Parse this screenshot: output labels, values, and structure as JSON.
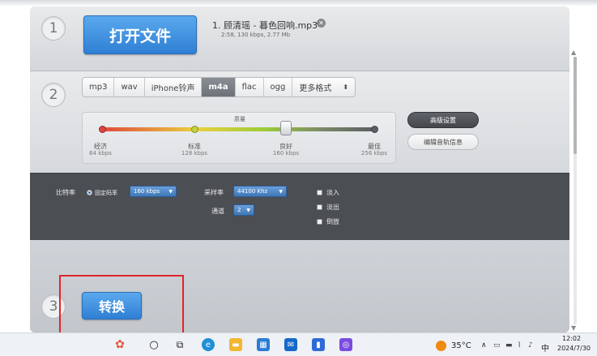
{
  "steps": {
    "one": "1",
    "two": "2",
    "three": "3"
  },
  "open_file_button": "打开文件",
  "file": {
    "name": "1. 顾清瑶 - 暮色回响.mp3",
    "meta": "2:58, 130 kbps, 2.77 Mb"
  },
  "formats": [
    {
      "label": "mp3",
      "active": false
    },
    {
      "label": "wav",
      "active": false
    },
    {
      "label": "iPhone铃声",
      "active": false
    },
    {
      "label": "m4a",
      "active": true
    },
    {
      "label": "flac",
      "active": false
    },
    {
      "label": "ogg",
      "active": false
    },
    {
      "label": "更多格式",
      "active": false
    }
  ],
  "quality": {
    "title": "质量",
    "levels": [
      {
        "label": "经济",
        "kbps": "64 kbps"
      },
      {
        "label": "标准",
        "kbps": "128 kbps"
      },
      {
        "label": "良好",
        "kbps": "160 kbps"
      },
      {
        "label": "最佳",
        "kbps": "256 kbps"
      }
    ],
    "selected_index": 2
  },
  "advanced_settings_button": "高级设置",
  "edit_track_info_button": "编辑音轨信息",
  "settings": {
    "bitrate_label": "比特率",
    "constant_bitrate_label": "固定码率",
    "bitrate_value": "160 kbps",
    "samplerate_label": "采样率",
    "samplerate_value": "44100 Khz",
    "channels_label": "通道",
    "channels_value": "2",
    "fade_in": "淡入",
    "fade_out": "淡出",
    "reverse": "倒放"
  },
  "convert_button": "转换",
  "taskbar": {
    "weather": "35°C",
    "ime": "中",
    "time": "12:02",
    "date": "2024/7/30"
  },
  "colors": {
    "accent_blue": "#2f7fd4",
    "highlight_red": "#e0242a",
    "dark_panel": "#4b4e53"
  }
}
